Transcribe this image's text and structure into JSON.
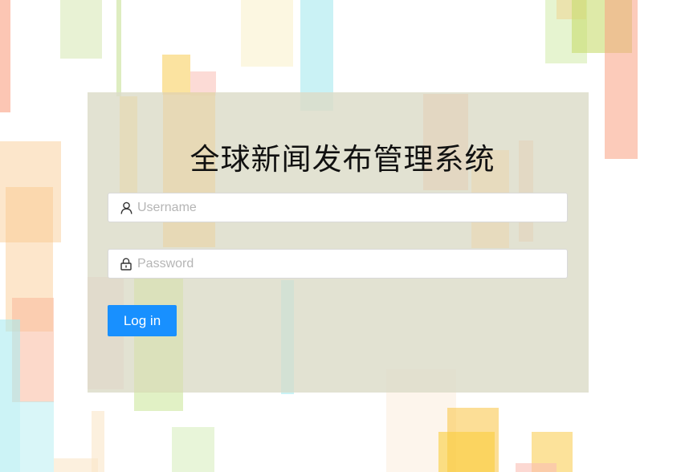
{
  "app": {
    "title": "全球新闻发布管理系统"
  },
  "login_form": {
    "username": {
      "placeholder": "Username",
      "value": "",
      "icon": "user-icon"
    },
    "password": {
      "placeholder": "Password",
      "value": "",
      "icon": "lock-icon"
    },
    "submit_label": "Log in",
    "accent_color": "#1890ff"
  }
}
